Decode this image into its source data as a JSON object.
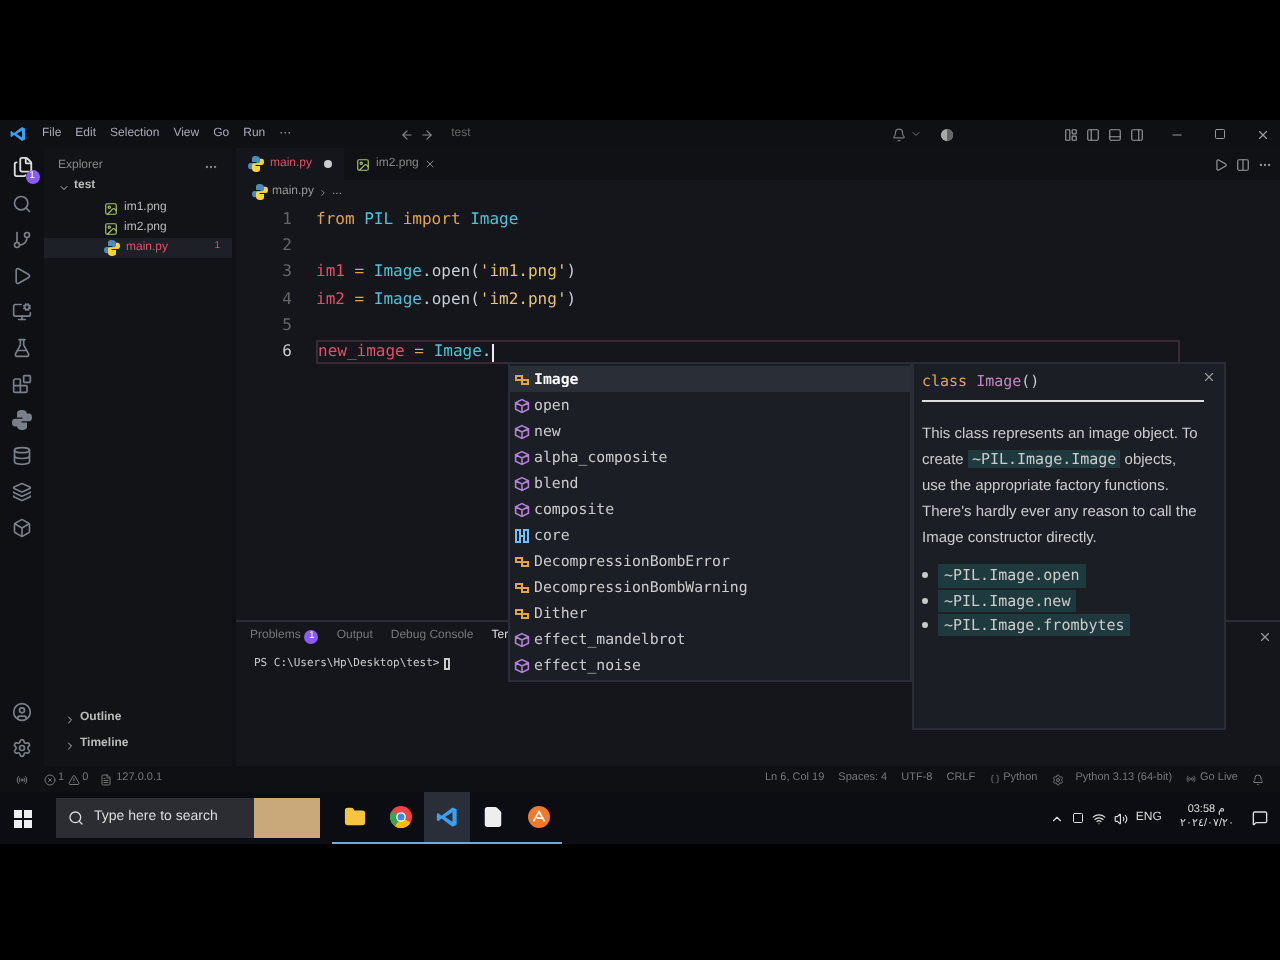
{
  "titlebar": {
    "menu": [
      "File",
      "Edit",
      "Selection",
      "View",
      "Go",
      "Run",
      "···"
    ],
    "title": "test"
  },
  "activity_bar": {
    "badge": "1"
  },
  "sidebar": {
    "title": "Explorer",
    "folder": {
      "name": "test",
      "expanded": true,
      "files": [
        {
          "name": "im1.png",
          "kind": "image",
          "selected": false
        },
        {
          "name": "im2.png",
          "kind": "image",
          "selected": false
        },
        {
          "name": "main.py",
          "kind": "python",
          "selected": true,
          "badge": "1"
        }
      ]
    },
    "sections": [
      "Outline",
      "Timeline"
    ]
  },
  "tabs": [
    {
      "label": "main.py",
      "kind": "python",
      "selected": true,
      "modified": true
    },
    {
      "label": "im2.png",
      "kind": "image",
      "selected": false,
      "modified": false
    }
  ],
  "breadcrumb": [
    "main.py",
    "..."
  ],
  "code": [
    {
      "number": "1",
      "current": false,
      "tokens": [
        {
          "text": "from",
          "kind": "keyword"
        },
        {
          "text": " PIL ",
          "kind": "module"
        },
        {
          "text": "import",
          "kind": "keyword"
        },
        {
          "text": " Image",
          "kind": "module"
        }
      ]
    },
    {
      "number": "2",
      "current": false
    },
    {
      "number": "3",
      "current": false,
      "tokens": [
        {
          "text": "im1",
          "kind": "variable"
        },
        {
          "text": " = ",
          "kind": "operator"
        },
        {
          "text": "Image",
          "kind": "module"
        },
        {
          "text": ".open(",
          "kind": "plain"
        },
        {
          "text": "'im1.png'",
          "kind": "string"
        },
        {
          "text": ")",
          "kind": "plain"
        }
      ]
    },
    {
      "number": "4",
      "current": false,
      "tokens": [
        {
          "text": "im2",
          "kind": "variable"
        },
        {
          "text": " = ",
          "kind": "operator"
        },
        {
          "text": "Image",
          "kind": "module"
        },
        {
          "text": ".open(",
          "kind": "plain"
        },
        {
          "text": "'im2.png'",
          "kind": "string"
        },
        {
          "text": ")",
          "kind": "plain"
        }
      ]
    },
    {
      "number": "5",
      "current": false
    },
    {
      "number": "6",
      "current": true,
      "tokens": [
        {
          "text": "new_image",
          "kind": "variable"
        },
        {
          "text": " = ",
          "kind": "operator"
        },
        {
          "text": "Image",
          "kind": "module"
        },
        {
          "text": ".",
          "kind": "plain"
        }
      ]
    }
  ],
  "suggestions": [
    {
      "label": "Image",
      "kind": "class",
      "selected": true
    },
    {
      "label": "open",
      "kind": "function",
      "selected": false
    },
    {
      "label": "new",
      "kind": "function",
      "selected": false
    },
    {
      "label": "alpha_composite",
      "kind": "function",
      "selected": false
    },
    {
      "label": "blend",
      "kind": "function",
      "selected": false
    },
    {
      "label": "composite",
      "kind": "function",
      "selected": false
    },
    {
      "label": "core",
      "kind": "module",
      "selected": false
    },
    {
      "label": "DecompressionBombError",
      "kind": "class",
      "selected": false
    },
    {
      "label": "DecompressionBombWarning",
      "kind": "class",
      "selected": false
    },
    {
      "label": "Dither",
      "kind": "class",
      "selected": false
    },
    {
      "label": "effect_mandelbrot",
      "kind": "function",
      "selected": false
    },
    {
      "label": "effect_noise",
      "kind": "function",
      "selected": false
    }
  ],
  "docs": {
    "signature": [
      {
        "text": "class",
        "kind": "keyword"
      },
      {
        "text": " Image",
        "kind": "name"
      },
      {
        "text": "()",
        "kind": "plain"
      }
    ],
    "text_before": "This class represents an image object. To create",
    "code_ref": "~PIL.Image.Image",
    "text_after": "objects, use the appropriate factory functions. There's hardly ever any reason to call the Image constructor directly.",
    "bullets": [
      "~PIL.Image.open",
      "~PIL.Image.new",
      "~PIL.Image.frombytes"
    ]
  },
  "panel": {
    "tabs": [
      {
        "label": "Problems",
        "badge": "1",
        "selected": false
      },
      {
        "label": "Output",
        "selected": false
      },
      {
        "label": "Debug Console",
        "selected": false
      },
      {
        "label": "Ter",
        "selected": true
      }
    ],
    "terminal": "PS C:\\Users\\Hp\\Desktop\\test>"
  },
  "status_bar": {
    "errors": "1",
    "warnings": "0",
    "port": "127.0.0.1",
    "right": [
      {
        "text": "Ln 6, Col 19",
        "kind": "text"
      },
      {
        "text": "Spaces: 4",
        "kind": "text"
      },
      {
        "text": "UTF-8",
        "kind": "text"
      },
      {
        "text": "CRLF",
        "kind": "text"
      },
      {
        "text": "Python",
        "kind": "language"
      },
      {
        "text": "Python 3.13 (64-bit)",
        "kind": "interpreter"
      },
      {
        "text": "Go Live",
        "kind": "live"
      }
    ]
  },
  "taskbar": {
    "search_placeholder": "Type here to search",
    "apps": [
      {
        "kind": "files",
        "selected": false
      },
      {
        "kind": "chrome",
        "selected": false
      },
      {
        "kind": "vscode",
        "selected": true
      },
      {
        "kind": "notepad",
        "selected": false
      },
      {
        "kind": "other",
        "selected": false
      }
    ],
    "language": "ENG",
    "time": "03:58 م",
    "date": "٢٠٢٤/٠٧/٢٠"
  }
}
